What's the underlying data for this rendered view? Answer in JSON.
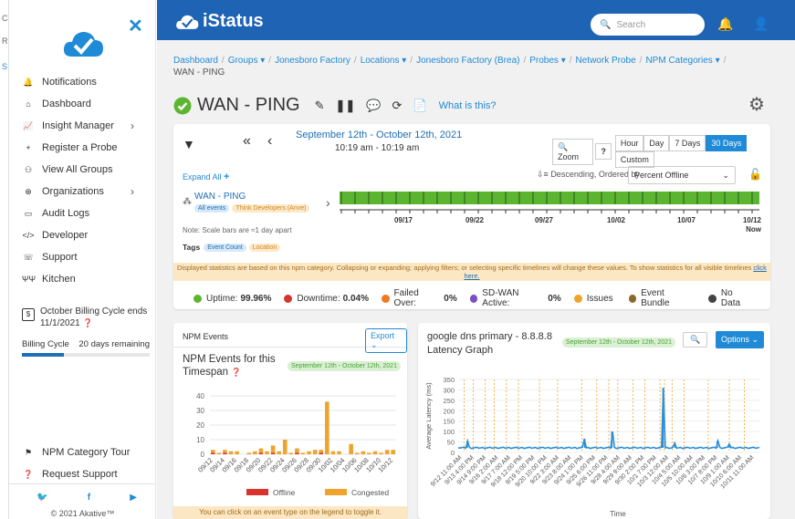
{
  "strip": {
    "a": "C",
    "b": "R",
    "c": "S"
  },
  "sidebar": {
    "close_icon": "close-icon",
    "items": [
      {
        "label": "Notifications",
        "icon": "bell-icon"
      },
      {
        "label": "Dashboard",
        "icon": "home-icon"
      },
      {
        "label": "Insight Manager",
        "icon": "chart-icon",
        "chevron": true
      },
      {
        "label": "Register a Probe",
        "icon": "plus-icon"
      },
      {
        "label": "View All Groups",
        "icon": "sitemap-icon"
      },
      {
        "label": "Organizations",
        "icon": "globe-icon",
        "chevron": true
      },
      {
        "label": "Audit Logs",
        "icon": "clipboard-icon"
      },
      {
        "label": "Developer",
        "icon": "code-icon"
      },
      {
        "label": "Support",
        "icon": "support-icon"
      },
      {
        "label": "Kitchen",
        "icon": "utensils-icon"
      }
    ],
    "billing": {
      "title": "October Billing Cycle ends 11/1/2021",
      "label": "Billing Cycle",
      "remaining": "20 days remaining",
      "progress": 0.33
    },
    "bottom_items": [
      {
        "label": "NPM Category Tour",
        "icon": "tour-icon"
      },
      {
        "label": "Request Support",
        "icon": "question-icon"
      }
    ],
    "copyright": "© 2021 Akative™"
  },
  "topbar": {
    "brand": "iStatus",
    "search_placeholder": "Search"
  },
  "breadcrumbs": [
    "Dashboard",
    "Groups ▾",
    "Jonesboro Factory",
    "Locations ▾",
    "Jonesboro Factory (Brea)",
    "Probes ▾",
    "Network Probe",
    "NPM Categories ▾"
  ],
  "breadcrumb_current": "WAN - PING",
  "page": {
    "title": "WAN - PING",
    "what_link": "What is this?"
  },
  "timeline": {
    "date_range": "September 12th - October 12th, 2021",
    "time_range": "10:19 am - 10:19 am",
    "zoom_label": "Zoom",
    "ranges": [
      "Hour",
      "Day",
      "7 Days",
      "30 Days",
      "Custom"
    ],
    "active_range": "30 Days",
    "expand_all": "Expand All",
    "sort_label": "Descending, Ordered by",
    "sort_value": "Percent Offline",
    "probe_name": "WAN - PING",
    "pill_all": "All events",
    "pill_source": "Think Developers (Anve)",
    "ticks": [
      "09/17",
      "09/22",
      "09/27",
      "10/02",
      "10/07",
      "10/12"
    ],
    "now": "Now",
    "note": "Note: Scale bars are ≈1 day apart",
    "tags_label": "Tags",
    "tag1": "Event Count",
    "tag2": "Location",
    "notice": "Displayed statistics are based on this npm category. Collapsing or expanding; applying filters; or selecting specific timelines will change these values. To show statistics for all visible timelines",
    "notice_link": "click here."
  },
  "stats": [
    {
      "label": "Uptime:",
      "value": "99.96%",
      "color": "#5cb531"
    },
    {
      "label": "Downtime:",
      "value": "0.04%",
      "color": "#d9332e"
    },
    {
      "label": "Failed Over:",
      "value": "0%",
      "color": "#f07a22"
    },
    {
      "label": "SD-WAN Active:",
      "value": "0%",
      "color": "#7a4fc4"
    },
    {
      "label": "Issues",
      "value": "",
      "color": "#f0a32a"
    },
    {
      "label": "Event Bundle",
      "value": "",
      "color": "#8a6a2a"
    },
    {
      "label": "No Data",
      "value": "",
      "color": "#444444"
    }
  ],
  "npm_events": {
    "tab": "NPM Events",
    "export": "Export",
    "title": "NPM Events for this Timespan",
    "date_pill": "September 12th - October 12th, 2021",
    "footer": "You can click on an event type on the legend to toggle it.",
    "chart_data": {
      "type": "bar",
      "categories": [
        "09/12",
        "09/13",
        "09/14",
        "09/15",
        "09/16",
        "09/17",
        "09/18",
        "09/19",
        "09/20",
        "09/21",
        "09/22",
        "09/23",
        "09/24",
        "09/25",
        "09/26",
        "09/27",
        "09/28",
        "09/29",
        "09/30",
        "10/01",
        "10/02",
        "10/03",
        "10/04",
        "10/05",
        "10/06",
        "10/07",
        "10/08",
        "10/09",
        "10/10",
        "10/11",
        "10/12"
      ],
      "tick_labels": [
        "09/12",
        "09/14",
        "09/16",
        "09/18",
        "09/20",
        "09/22",
        "09/24",
        "09/26",
        "09/28",
        "09/30",
        "10/02",
        "10/04",
        "10/06",
        "10/08",
        "10/10",
        "10/12"
      ],
      "series": [
        {
          "name": "Offline",
          "color": "#d9332e",
          "values": [
            1,
            0,
            1,
            0,
            0,
            0,
            0,
            0,
            1,
            0,
            1,
            0,
            0,
            0,
            1,
            0,
            0,
            0,
            1,
            0,
            0,
            0,
            0,
            0,
            0,
            0,
            0,
            0,
            0,
            0,
            0
          ]
        },
        {
          "name": "Congested",
          "color": "#f0a32a",
          "values": [
            2,
            1,
            2,
            2,
            2,
            0,
            1,
            2,
            3,
            2,
            5,
            2,
            10,
            1,
            3,
            1,
            2,
            3,
            2,
            36,
            2,
            2,
            0,
            7,
            1,
            2,
            1,
            2,
            1,
            3,
            3
          ]
        }
      ],
      "ylim": [
        0,
        40
      ],
      "yticks": [
        0,
        10,
        20,
        30,
        40
      ]
    }
  },
  "latency": {
    "title": "google dns primary - 8.8.8.8 Latency Graph",
    "date_pill": "September 12th - October 12th, 2021",
    "options": "Options",
    "chart_data": {
      "type": "line",
      "ylabel": "Average Latency (ms)",
      "xlabel": "Time",
      "ylim": [
        0,
        350
      ],
      "yticks": [
        0,
        50,
        100,
        150,
        200,
        250,
        300,
        350
      ],
      "xticks": [
        "9/12 11:00 AM",
        "9/13 4:00 PM",
        "9/14 9:00 PM",
        "9/16 2:00 AM",
        "9/17 7:00 AM",
        "9/18 12:00 PM",
        "9/19 5:00 PM",
        "9/20 10:00 PM",
        "9/22 3:00 AM",
        "9/23 8:00 AM",
        "9/24 1:00 PM",
        "9/25 6:00 PM",
        "9/26 11:00 PM",
        "9/28 4:00 AM",
        "9/29 9:00 AM",
        "9/30 2:00 PM",
        "10/1 7:00 PM",
        "10/3 12:00 AM",
        "10/4 5:00 AM",
        "10/5 10:00 AM",
        "10/6 3:00 PM",
        "10/7 8:00 PM",
        "10/9 1:00 AM",
        "10/10 6:00 AM",
        "10/11 11:00 AM"
      ],
      "baseline": 22,
      "spikes": [
        {
          "t": 0.03,
          "v": 55
        },
        {
          "t": 0.42,
          "v": 65
        },
        {
          "t": 0.51,
          "v": 100
        },
        {
          "t": 0.68,
          "v": 310
        },
        {
          "t": 0.72,
          "v": 45
        },
        {
          "t": 0.86,
          "v": 55
        },
        {
          "t": 0.9,
          "v": 40
        }
      ],
      "congested_positions": [
        0.02,
        0.05,
        0.09,
        0.12,
        0.16,
        0.2,
        0.27,
        0.33,
        0.41,
        0.46,
        0.5,
        0.53,
        0.58,
        0.62,
        0.67,
        0.685,
        0.71,
        0.75,
        0.83,
        0.9,
        0.95
      ]
    }
  }
}
